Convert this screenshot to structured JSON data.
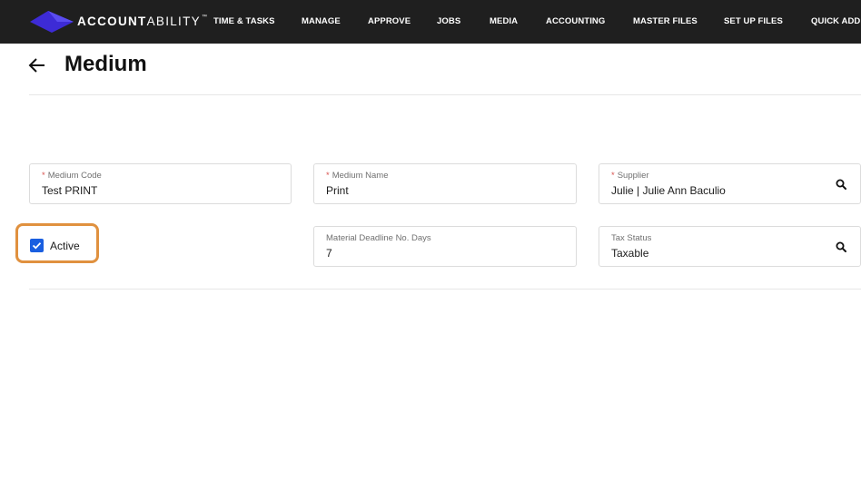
{
  "brand": {
    "name_bold": "ACCOUNT",
    "name_regular": "ABILITY",
    "trademark": "™"
  },
  "nav": {
    "time_tasks": "TIME & TASKS",
    "manage": "MANAGE",
    "approve": "APPROVE",
    "jobs": "JOBS",
    "media": "MEDIA",
    "accounting": "ACCOUNTING",
    "master_files": "MASTER FILES",
    "set_up_files": "SET UP FILES",
    "quick_add": "QUICK ADD"
  },
  "page": {
    "title": "Medium"
  },
  "form": {
    "required_marker": "*",
    "medium_code": {
      "label": "Medium Code",
      "value": "Test PRINT",
      "required": true
    },
    "medium_name": {
      "label": "Medium Name",
      "value": "Print",
      "required": true
    },
    "supplier": {
      "label": "Supplier",
      "value": "Julie | Julie Ann Baculio",
      "required": true,
      "icon": "search-icon"
    },
    "active": {
      "label": "Active",
      "checked": true
    },
    "material_deadline": {
      "label": "Material Deadline No. Days",
      "value": "7"
    },
    "tax_status": {
      "label": "Tax Status",
      "value": "Taxable",
      "icon": "search-icon"
    }
  },
  "colors": {
    "topbar": "#1f1f1f",
    "logo": "#3d2bd6",
    "checkbox": "#1a5fe0",
    "highlight": "#e0913f",
    "required": "#d9534f"
  }
}
